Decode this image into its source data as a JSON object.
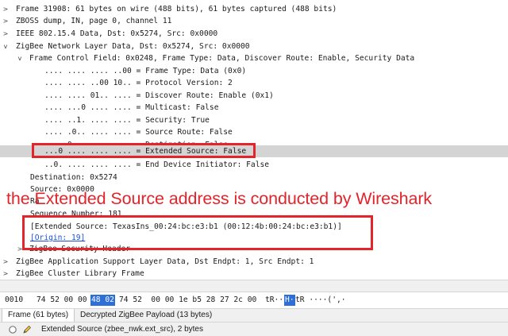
{
  "tree": [
    {
      "text": "Frame 31908: 61 bytes on wire (488 bits), 61 bytes captured (488 bits)",
      "toggle": ">"
    },
    {
      "text": "ZBOSS dump, IN, page 0, channel 11",
      "toggle": ">"
    },
    {
      "text": "IEEE 802.15.4 Data, Dst: 0x5274, Src: 0x0000",
      "toggle": ">"
    },
    {
      "text": "ZigBee Network Layer Data, Dst: 0x5274, Src: 0x0000",
      "toggle": "v"
    },
    {
      "text": "Frame Control Field: 0x0248, Frame Type: Data, Discover Route: Enable, Security Data",
      "toggle": "v"
    },
    {
      "text": ".... .... .... ..00 = Frame Type: Data (0x0)",
      "toggle": ""
    },
    {
      "text": ".... .... ..00 10.. = Protocol Version: 2",
      "toggle": ""
    },
    {
      "text": ".... .... 01.. .... = Discover Route: Enable (0x1)",
      "toggle": ""
    },
    {
      "text": ".... ...0 .... .... = Multicast: False",
      "toggle": ""
    },
    {
      "text": ".... ..1. .... .... = Security: True",
      "toggle": ""
    },
    {
      "text": ".... .0.. .... .... = Source Route: False",
      "toggle": ""
    },
    {
      "text": ".... 0... .... .... = Destination: False",
      "toggle": ""
    },
    {
      "text": "...0 .... .... .... = Extended Source: False",
      "toggle": ""
    },
    {
      "text": "..0. .... .... .... = End Device Initiator: False",
      "toggle": ""
    },
    {
      "text": "Destination: 0x5274",
      "toggle": ""
    },
    {
      "text": "Source: 0x0000",
      "toggle": ""
    },
    {
      "text": "Ra",
      "toggle": ""
    },
    {
      "text": "Sequence Number: 181",
      "toggle": ""
    },
    {
      "text": "[Extended Source: TexasIns_00:24:bc:e3:b1 (00:12:4b:00:24:bc:e3:b1)]",
      "toggle": ""
    },
    {
      "text": "[Origin: 19]",
      "toggle": ""
    },
    {
      "text": "ZigBee Security Header",
      "toggle": ">"
    },
    {
      "text": "ZigBee Application Support Layer Data, Dst Endpt: 1, Src Endpt: 1",
      "toggle": ">"
    },
    {
      "text": "ZigBee Cluster Library Frame",
      "toggle": ">"
    }
  ],
  "annotation": "the Extended Source address is conducted by Wireshark",
  "hex": {
    "offset": "0010",
    "bytes_pre": "74 52 00 00",
    "bytes_sel": "48 02",
    "bytes_post": "74 52  00 00 1e b5 28 27 2c 00",
    "ascii_pre": "tR··",
    "ascii_sel": "H·",
    "ascii_post": "tR ····(',·"
  },
  "tabs": [
    "Frame (61 bytes)",
    "Decrypted ZigBee Payload (13 bytes)"
  ],
  "status": {
    "text": "Extended Source (zbee_nwk.ext_src), 2 bytes",
    "icon_ready": "circle-icon",
    "icon_edit": "pencil-icon"
  },
  "colors": {
    "annotation_red": "#e3242b",
    "selection_blue": "#2d6fd6",
    "selected_row": "#d4d4d4"
  }
}
